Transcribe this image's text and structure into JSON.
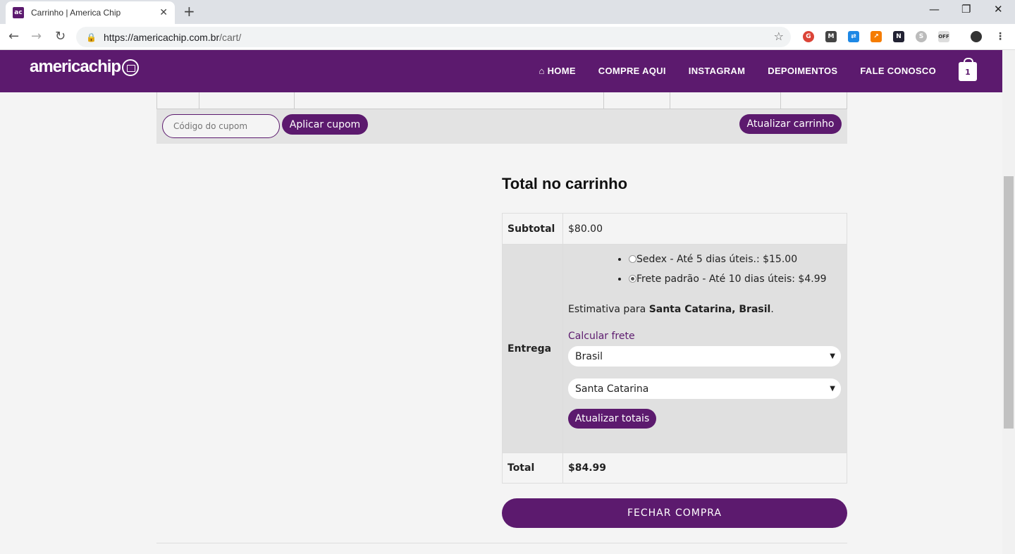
{
  "browser": {
    "tab_title": "Carrinho | America Chip",
    "tab_favicon": "ac",
    "url_host": "https://americachip.com.br",
    "url_path": "/cart/"
  },
  "site": {
    "logo_text": "americachip",
    "nav": [
      "HOME",
      "COMPRE AQUI",
      "INSTAGRAM",
      "DEPOIMENTOS",
      "FALE CONOSCO"
    ],
    "cart_count": "1",
    "brand_color": "#5c1a6e"
  },
  "coupon": {
    "placeholder": "Código do cupom",
    "apply_label": "Aplicar cupom",
    "update_cart_label": "Atualizar carrinho"
  },
  "totals": {
    "title": "Total no carrinho",
    "subtotal_label": "Subtotal",
    "subtotal_value": "$80.00",
    "shipping_label": "Entrega",
    "shipping_options": [
      {
        "label": "Sedex - Até 5 dias úteis.: $15.00",
        "selected": false
      },
      {
        "label": "Frete padrão - Até 10 dias úteis: $4.99",
        "selected": true
      }
    ],
    "estimate_prefix": "Estimativa para ",
    "estimate_location": "Santa Catarina, Brasil",
    "estimate_suffix": ".",
    "calc_link": "Calcular frete",
    "country": "Brasil",
    "state": "Santa Catarina",
    "update_totals_label": "Atualizar totais",
    "total_label": "Total",
    "total_value": "$84.99",
    "checkout_label": "FECHAR COMPRA"
  }
}
